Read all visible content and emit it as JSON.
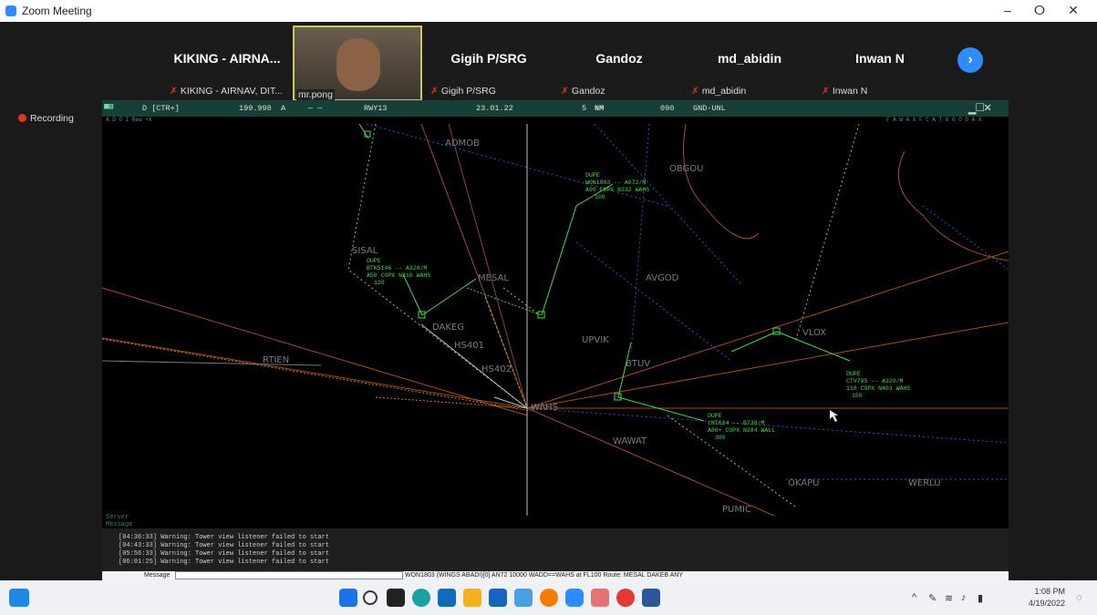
{
  "window": {
    "title": "Zoom Meeting",
    "minimize": "–",
    "restore": "ⵔ",
    "close": "✕"
  },
  "participants": [
    {
      "name": "KIKING - AIRNA...",
      "caption": "KIKING - AIRNAV, DIT..."
    },
    {
      "name": "",
      "caption": "mr.pong"
    },
    {
      "name": "Gigih P/SRG",
      "caption": "Gigih P/SRG"
    },
    {
      "name": "Gandoz",
      "caption": "Gandoz"
    },
    {
      "name": "md_abidin",
      "caption": "md_abidin"
    },
    {
      "name": "Inwan N",
      "caption": "Inwan N"
    }
  ],
  "next_page": "›",
  "recording": "Recording",
  "atc_toolbar": {
    "mode": "D [CTR+]",
    "freq": "199.998",
    "atis": "A",
    "dashes": "— —",
    "rwy": "RWY13",
    "date": "23.01.22",
    "range": "5",
    "range_unit": "NM",
    "hdg": "090",
    "alt": "GND-UNL",
    "subbar_left": "A D O I  Rew  +X",
    "subbar_right": "F A W A X   F C A T O O O O   A X"
  },
  "waypoints": {
    "admob": "ADMOB",
    "obgou": "OBGOU",
    "sisal": "SISAL",
    "mesal": "MESAL",
    "avgod": "AVGOD",
    "dakeg": "DAKEG",
    "hs401": "HS401",
    "hs402": "HS402",
    "upvik": "UPVIK",
    "btuv": "BTUV",
    "vlox": "VLOX",
    "rtien": "RTIEN",
    "wahs": "WAHS",
    "wawat": "WAWAT",
    "okapu": "OKAPU",
    "werlu": "WERLU",
    "pumic": "PUMIC"
  },
  "tags": [
    {
      "l1": "DUPE",
      "l2": "WON1803 -- A072/M",
      "l3": "A90 COPX B332 WAHS",
      "l4": "100"
    },
    {
      "l1": "DUPE",
      "l2": "BTK5146 -- A320/M",
      "l3": "A50 COPX N310 WAHS",
      "l4": "120"
    },
    {
      "l1": "DUPE",
      "l2": "CTV795 -- A320/M",
      "l3": "110 COPX N403 WAHS",
      "l4": "150"
    },
    {
      "l1": "DUPE",
      "l2": "LNI624 -- B738/M",
      "l3": "A80+ COPX N284 WALL",
      "l4": "380"
    }
  ],
  "server_labels": {
    "l1": "Server",
    "l2": "Message"
  },
  "log": [
    "[04:36:33] Warning: Tower view listener failed to start",
    "[04:43:33] Warning: Tower view listener failed to start",
    "[05:56:33] Warning: Tower view listener failed to start",
    "[06:01:25] Warning: Tower view listener failed to start"
  ],
  "input_bar": {
    "label": "Message",
    "text": "WON1803 (WINGS ABADI)[0] AN72 10000 WADD==WAHS at FL100 Route: MESAL DAKEB ANY"
  },
  "clock": {
    "time": "1:08 PM",
    "date": "4/19/2022"
  },
  "colors": {
    "zoom_blue": "#2d8cff",
    "radar_green": "#4bd64b",
    "toolbar": "#173e37"
  },
  "taskbar_icons": [
    "start-icon",
    "search-icon",
    "file-explorer-icon",
    "edge-icon",
    "mail-icon",
    "folder-icon",
    "store-icon",
    "photos-icon",
    "chrome-icon",
    "zoom-icon",
    "network-app-icon",
    "record-icon",
    "word-icon"
  ]
}
